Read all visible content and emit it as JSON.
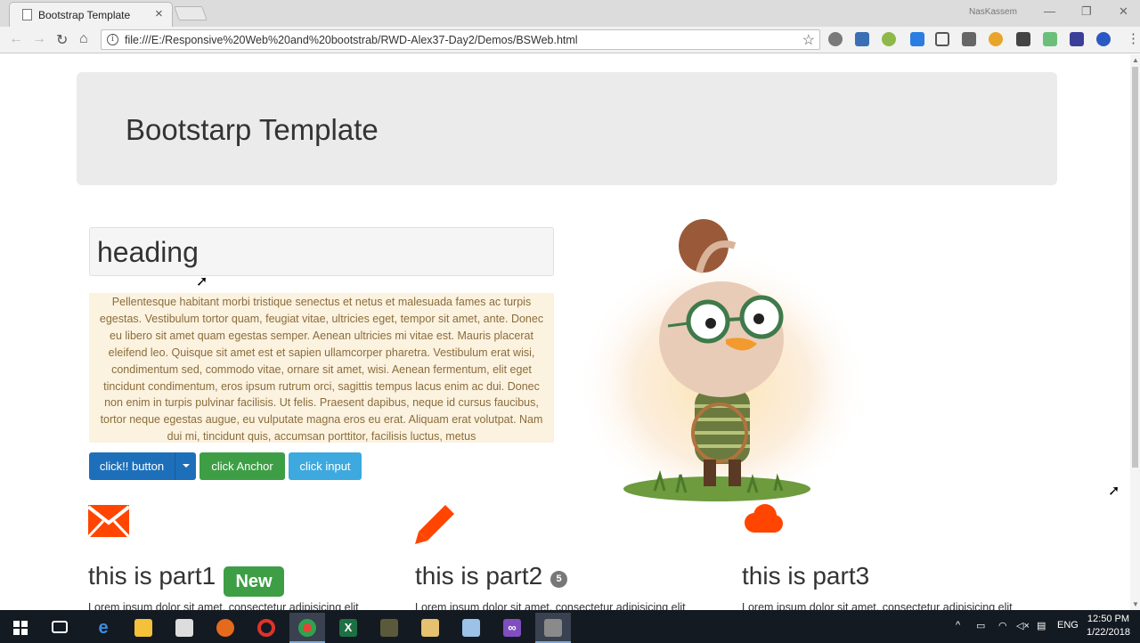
{
  "browser": {
    "tab_title": "Bootstrap Template",
    "user": "NasKassem",
    "url": "file:///E:/Responsive%20Web%20and%20bootstrab/RWD-Alex37-Day2/Demos/BSWeb.html"
  },
  "page": {
    "jumbotron_title": "Bootstarp Template",
    "heading": "heading",
    "paragraph": "Pellentesque habitant morbi tristique senectus et netus et malesuada fames ac turpis egestas. Vestibulum tortor quam, feugiat vitae, ultricies eget, tempor sit amet, ante. Donec eu libero sit amet quam egestas semper. Aenean ultricies mi vitae est. Mauris placerat eleifend leo. Quisque sit amet est et sapien ullamcorper pharetra. Vestibulum erat wisi, condimentum sed, commodo vitae, ornare sit amet, wisi. Aenean fermentum, elit eget tincidunt condimentum, eros ipsum rutrum orci, sagittis tempus lacus enim ac dui. Donec non enim in turpis pulvinar facilisis. Ut felis. Praesent dapibus, neque id cursus faucibus, tortor neque egestas augue, eu vulputate magna eros eu erat. Aliquam erat volutpat. Nam dui mi, tincidunt quis, accumsan porttitor, facilisis luctus, metus",
    "buttons": {
      "split": "click!! button",
      "anchor": "click Anchor",
      "input": "click input"
    },
    "features": [
      {
        "icon": "envelope-icon",
        "title": "this is part1",
        "label": "New",
        "text": "Lorem ipsum dolor sit amet, consectetur adipisicing elit"
      },
      {
        "icon": "pencil-icon",
        "title": "this is part2",
        "badge": "5",
        "text": "Lorem ipsum dolor sit amet, consectetur adipisicing elit"
      },
      {
        "icon": "cloud-icon",
        "title": "this is part3",
        "text": "Lorem ipsum dolor sit amet, consectetur adipisicing elit"
      }
    ],
    "accent_color": "#ff4500"
  },
  "taskbar": {
    "language": "ENG",
    "time": "12:50 PM",
    "date": "1/22/2018"
  }
}
